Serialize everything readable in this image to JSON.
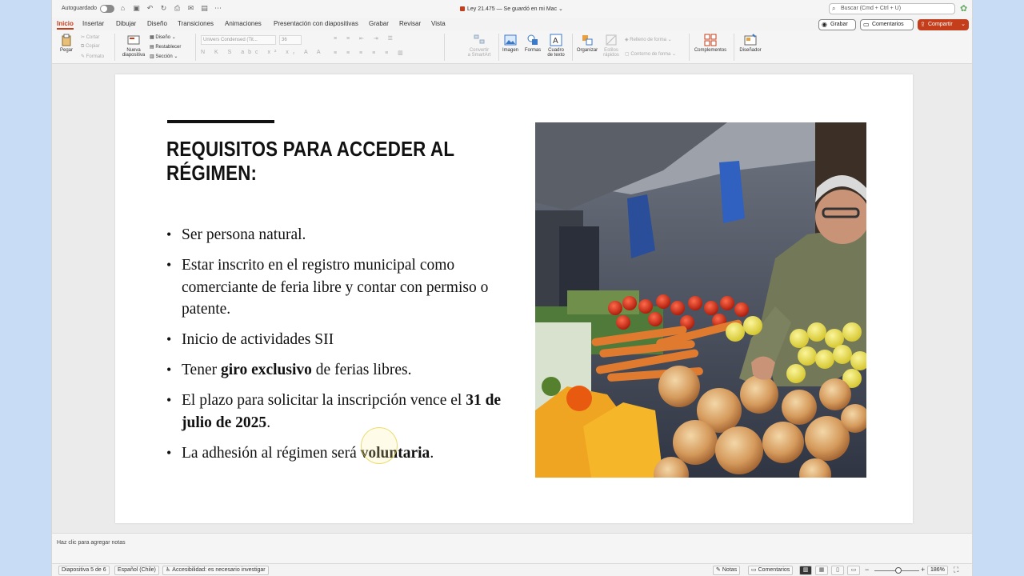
{
  "titlebar": {
    "autosave_label": "Autoguardado",
    "doc_title": "Ley 21.475 — Se guardó en mi Mac",
    "search_placeholder": "Buscar (Cmd + Ctrl + U)"
  },
  "tabs": [
    "Inicio",
    "Insertar",
    "Dibujar",
    "Diseño",
    "Transiciones",
    "Animaciones",
    "Presentación con diapositivas",
    "Grabar",
    "Revisar",
    "Vista"
  ],
  "header_buttons": {
    "record": "Grabar",
    "comments": "Comentarios",
    "share": "Compartir"
  },
  "ribbon": {
    "paste": "Pegar",
    "cut": "Cortar",
    "copy": "Copiar",
    "format": "Formato",
    "new_slide_1": "Nueva",
    "new_slide_2": "diapositiva",
    "layout": "Diseño",
    "reset": "Restablecer",
    "section": "Sección",
    "font_name": "Univers Condensed (Tit...",
    "font_size": "36",
    "convert_1": "Convertir",
    "convert_2": "a SmartArt",
    "image": "Imagen",
    "shapes": "Formas",
    "textbox_1": "Cuadro",
    "textbox_2": "de texto",
    "arrange": "Organizar",
    "quick_styles_1": "Estilos",
    "quick_styles_2": "rápidos",
    "shape_fill": "Relleno de forma",
    "shape_outline": "Contorno de forma",
    "addins": "Complementos",
    "designer": "Diseñador"
  },
  "slide": {
    "title": "REQUISITOS PARA ACCEDER AL RÉGIMEN:",
    "b1": "Ser persona natural.",
    "b2": "Estar inscrito en el registro municipal como comerciante de feria libre y contar con permiso o patente.",
    "b3": "Inicio de actividades SII",
    "b4_pre": "Tener ",
    "b4_bold": "giro exclusivo",
    "b4_post": " de ferias libres.",
    "b5_pre": "El plazo para solicitar la inscripción vence el ",
    "b5_bold": "31 de julio de 2025",
    "b5_post": ".",
    "b6_pre": "La adhesión al régimen será ",
    "b6_bold": "voluntaria",
    "b6_post": "."
  },
  "notes_placeholder": "Haz clic para agregar notas",
  "status": {
    "slide_counter": "Diapositiva 5 de 6",
    "language": "Español (Chile)",
    "accessibility": "Accesibilidad: es necesario investigar",
    "notes": "Notas",
    "comments": "Comentarios",
    "zoom": "186%"
  },
  "colors": {
    "accent": "#c43e1c",
    "canvas": "#ebebeb",
    "desktop": "#c9dcf5"
  }
}
